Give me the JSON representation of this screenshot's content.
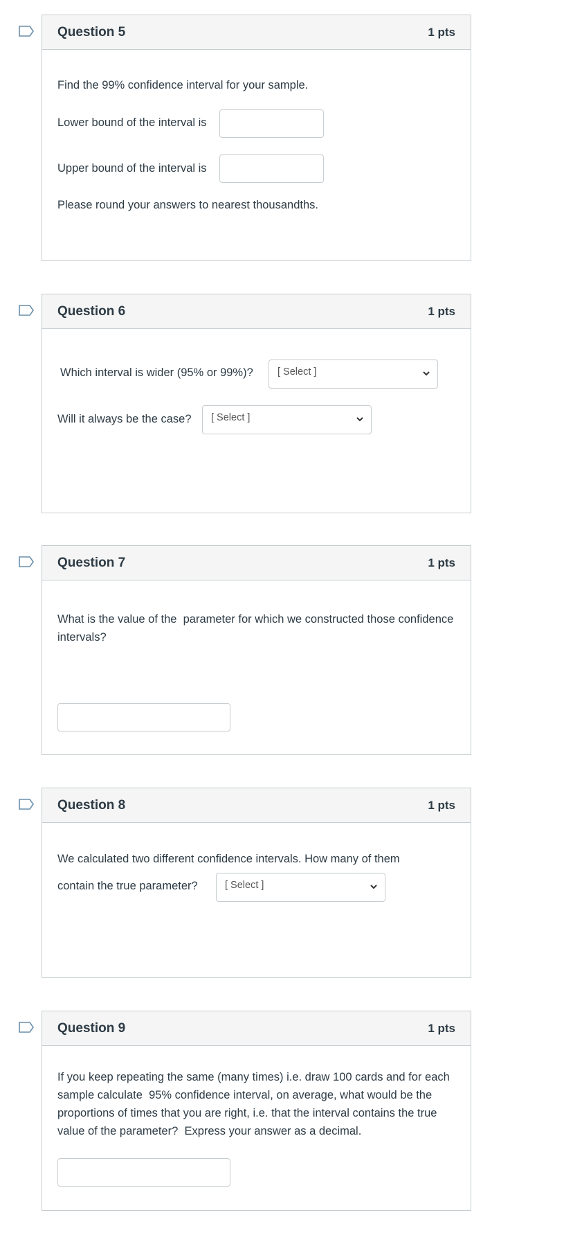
{
  "questions": [
    {
      "number": 5,
      "title": "Question 5",
      "points": "1 pts",
      "prompt": "Find the 99% confidence interval for your sample.",
      "lower_label": "Lower bound of the interval is",
      "lower_value": "",
      "upper_label": "Upper bound of the interval is",
      "upper_value": "",
      "note": "Please round your answers to nearest thousandths."
    },
    {
      "number": 6,
      "title": "Question 6",
      "points": "1 pts",
      "q1_label": "Which interval is wider (95% or 99%)?",
      "q1_select": "[ Select ]",
      "q2_label": "Will it always be the case?",
      "q2_select": "[ Select ]"
    },
    {
      "number": 7,
      "title": "Question 7",
      "points": "1 pts",
      "prompt": "What is the value of the  parameter for which we constructed those confidence intervals?",
      "answer_value": ""
    },
    {
      "number": 8,
      "title": "Question 8",
      "points": "1 pts",
      "prompt_line1": "We calculated two different confidence intervals. How many of them",
      "prompt_line2": "contain the true parameter?",
      "select": "[ Select ]"
    },
    {
      "number": 9,
      "title": "Question 9",
      "points": "1 pts",
      "prompt": "If you keep repeating the same (many times) i.e. draw 100 cards and for each sample calculate  95% confidence interval, on average, what would be the proportions of times that you are right, i.e. that the interval contains the true value of the parameter?  Express your answer as a decimal.",
      "answer_value": ""
    }
  ],
  "icons": {
    "flag": "flag-outline-icon",
    "select_chevron": "chevron-down-icon"
  },
  "colors": {
    "header_bg": "#f5f5f5",
    "border": "#c7cdd1",
    "text": "#2d3b45",
    "flag": "#6a8eaa"
  }
}
